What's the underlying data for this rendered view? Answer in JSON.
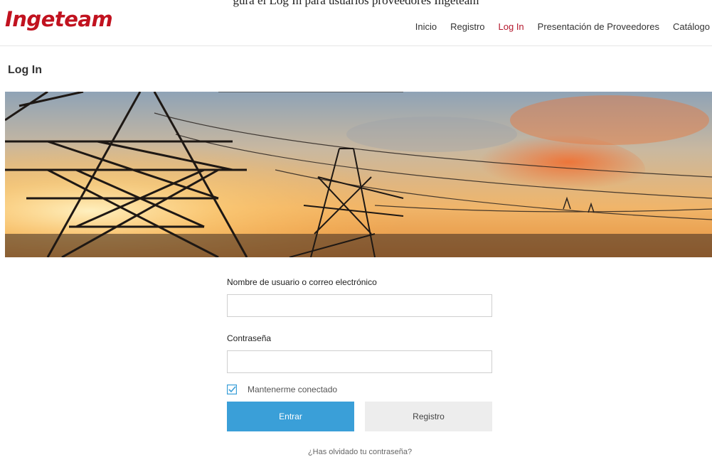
{
  "top_caption": "gura el Log In para usuarios proveedores Ingeteam",
  "brand": {
    "logo_text": "Ingeteam",
    "accent": "#c1121f"
  },
  "nav": {
    "items": [
      {
        "label": "Inicio"
      },
      {
        "label": "Registro"
      },
      {
        "label": "Log In",
        "active": true
      },
      {
        "label": "Presentación de Proveedores"
      },
      {
        "label": "Catálogo"
      }
    ],
    "active_color": "#b4182d"
  },
  "page": {
    "title": "Log In"
  },
  "hero": {
    "icon": "power-towers-sunset-image"
  },
  "form": {
    "username_label": "Nombre de usuario o correo electrónico",
    "username_value": "",
    "password_label": "Contraseña",
    "password_value": "",
    "remember_label": "Mantenerme conectado",
    "remember_checked": true,
    "submit_label": "Entrar",
    "register_label": "Registro",
    "forgot_label": "¿Has olvidado tu contraseña?",
    "primary_color": "#3a9fd8"
  }
}
